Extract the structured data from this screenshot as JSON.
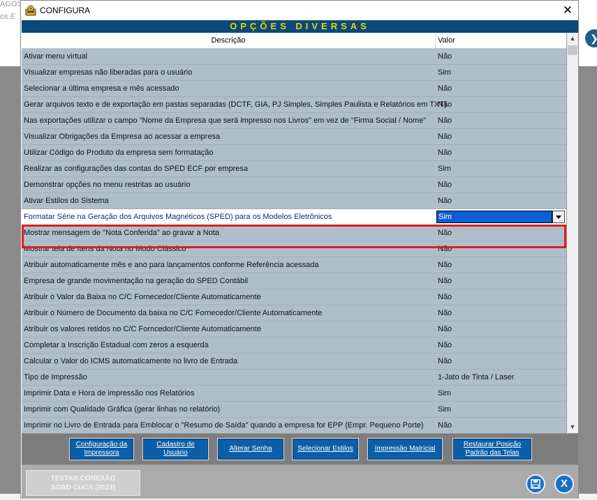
{
  "background": {
    "top_text": "AGOS",
    "top_text2": "os  E"
  },
  "window": {
    "title": "CONFIGURA",
    "close_glyph": "✕"
  },
  "header": {
    "title": "OPÇÕES DIVERSAS"
  },
  "columns": {
    "description": "Descrição",
    "value": "Valor"
  },
  "rows": [
    {
      "desc": "Ativar menu virtual",
      "val": "Não"
    },
    {
      "desc": "Visualizar empresas não liberadas para o usuário",
      "val": "Sim"
    },
    {
      "desc": "Selecionar a última empresa e mês acessado",
      "val": "Não"
    },
    {
      "desc": "Gerar arquivos texto e de exportação em pastas separadas (DCTF, GIA, PJ Simples, Simples Paulista e Relatórios em TXT)",
      "val": "Não"
    },
    {
      "desc": "Nas exportações utilizar o campo \"Nome da Empresa que será impresso nos Livros\" em vez de \"Firma Social / Nome\"",
      "val": "Não"
    },
    {
      "desc": "Visualizar Obrigações da Empresa ao acessar a empresa",
      "val": "Não"
    },
    {
      "desc": "Utilizar Código do Produto da empresa sem formatação",
      "val": "Não"
    },
    {
      "desc": "Realizar as configurações das contas do SPED ECF por empresa",
      "val": "Sim"
    },
    {
      "desc": "Demonstrar opções no menu restritas ao usuário",
      "val": "Não"
    },
    {
      "desc": "Ativar Estilos do Sistema",
      "val": "Não"
    },
    {
      "desc": "Formatar Série na Geração dos Arquivos Magnéticos (SPED) para os Modelos Eletrônicos",
      "val": "Sim",
      "selected": true
    },
    {
      "desc": "Mostrar mensagem de \"Nota Conferida\" ao gravar a Nota",
      "val": "Não"
    },
    {
      "desc": "Mostrar tela de Itens da Nota no Modo Clássico",
      "val": "Não"
    },
    {
      "desc": "Atribuir automaticamente mês e ano para lançamentos conforme Referência acessada",
      "val": "Não"
    },
    {
      "desc": "Empresa de grande movimentação na geração do SPED Contábil",
      "val": "Não"
    },
    {
      "desc": "Atribuir o Valor da Baixa no C/C Fornecedor/Cliente Automaticamente",
      "val": "Não"
    },
    {
      "desc": "Atribuir o Número de Documento da baixa no C/C Fornecedor/Cliente Automaticamente",
      "val": "Não"
    },
    {
      "desc": "Atribuir os valores retidos no C/C Forncedor/Cliente Automaticamente",
      "val": "Não"
    },
    {
      "desc": "Completar a Inscrição Estadual com zeros a esquerda",
      "val": "Não"
    },
    {
      "desc": "Calcular o Valor do ICMS automaticamente no livro de Entrada",
      "val": "Não"
    },
    {
      "desc": "Tipo de Impressão",
      "val": "1-Jato de Tinta / Laser"
    },
    {
      "desc": "Imprimir Data e Hora de impressão nos Relatórios",
      "val": "Sim"
    },
    {
      "desc": "Imprimir com Qualidade Gráfica (gerar linhas no relatório)",
      "val": "Sim"
    },
    {
      "desc": "Imprimir no Livro de Entrada para Emblocar o \"Resumo de Saída\" quando a empresa for EPP (Empr. Pequeno Porte)",
      "val": "Não"
    }
  ],
  "toolbar": {
    "buttons": [
      {
        "label_1": "Configuração da",
        "label_2": "Impressora"
      },
      {
        "label_1": "Cadastro de",
        "label_2": "Usuário"
      },
      {
        "label_1": "Alterar Senha",
        "label_2": ""
      },
      {
        "label_1": "Selecionar Estilos",
        "label_2": ""
      },
      {
        "label_1": "Impressão Matricial",
        "label_2": ""
      },
      {
        "label_1": "Restaurar Posição",
        "label_2": "Padrão das Telas"
      }
    ]
  },
  "bottom": {
    "test_line1": "TESTAR CONEXÃO",
    "test_line2": "SGBD CUCA (2023)",
    "save_glyph": "💾",
    "exit_glyph": "X"
  },
  "colors": {
    "header_bg": "#0a4a7a",
    "header_text": "#f2d000",
    "grid_bg": "#aebfc9",
    "button_bg": "#0b5ea8",
    "highlight": "#e01b24",
    "selected_value_bg": "#0a5fd8"
  }
}
